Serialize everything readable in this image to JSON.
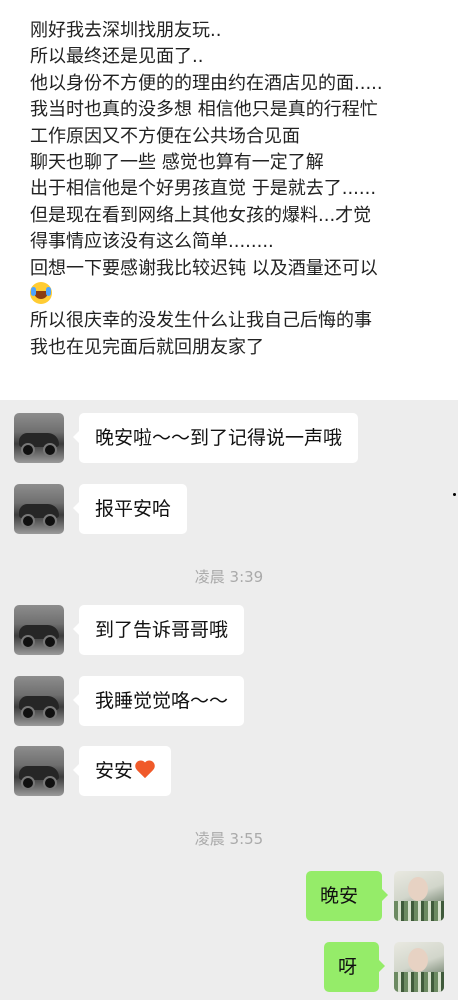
{
  "note": {
    "lines": [
      "刚好我去深圳找朋友玩..",
      "所以最终还是见面了..",
      "他以身份不方便的的理由约在酒店见的面.....",
      "我当时也真的没多想 相信他只是真的行程忙",
      "工作原因又不方便在公共场合见面",
      "聊天也聊了一些 感觉也算有一定了解",
      "出于相信他是个好男孩直觉 于是就去了......",
      "但是现在看到网络上其他女孩的爆料...才觉",
      "得事情应该没有这么简单........",
      "回想一下要感谢我比较迟钝 以及酒量还可以",
      "",
      "所以很庆幸的没发生什么让我自己后悔的事",
      "我也在见完面后就回朋友家了"
    ],
    "emoji_icon": "laughing-tears-emoji"
  },
  "chat": {
    "timestamps": [
      "凌晨 3:39",
      "凌晨 3:55"
    ],
    "incoming": [
      {
        "text": "晚安啦～～到了记得说一声哦",
        "avatar": "car-avatar"
      },
      {
        "text": "报平安哈",
        "avatar": "car-avatar"
      },
      {
        "text": "到了告诉哥哥哦",
        "avatar": "car-avatar"
      },
      {
        "text": "我睡觉觉咯～～",
        "avatar": "car-avatar"
      },
      {
        "text": "安安",
        "avatar": "car-avatar",
        "icon": "orange-heart-icon"
      }
    ],
    "outgoing": [
      {
        "text": "晚安",
        "avatar": "user-avatar"
      },
      {
        "text": "呀",
        "avatar": "user-avatar"
      }
    ]
  },
  "colors": {
    "chat_background": "#ededed",
    "incoming_bubble": "#ffffff",
    "outgoing_bubble": "#95ec69",
    "timestamp_text": "#aaaaaa",
    "heart": "#f05a2a"
  }
}
